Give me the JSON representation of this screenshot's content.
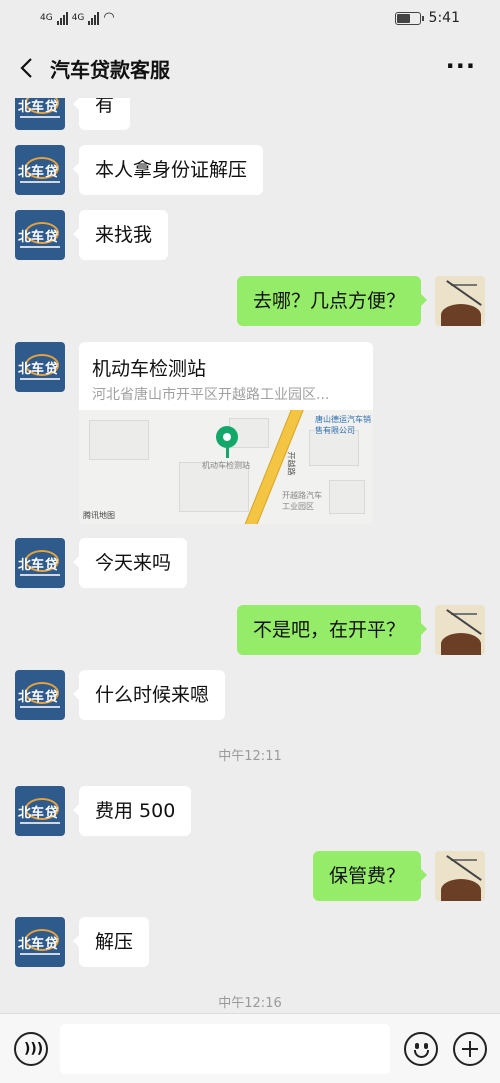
{
  "status_bar": {
    "network_1": "4G",
    "network_2": "4G",
    "time": "5:41",
    "battery_level": 0.6
  },
  "header": {
    "title": "汽车贷款客服"
  },
  "messages": [
    {
      "id": "m1",
      "side": "left",
      "text": "有"
    },
    {
      "id": "m2",
      "side": "left",
      "text": "本人拿身份证解压"
    },
    {
      "id": "m3",
      "side": "left",
      "text": "来找我"
    },
    {
      "id": "m4",
      "side": "right",
      "text": "去哪？几点方便？"
    },
    {
      "id": "m5",
      "side": "left",
      "type": "location"
    },
    {
      "id": "m6",
      "side": "left",
      "text": "今天来吗"
    },
    {
      "id": "m7",
      "side": "right",
      "text": "不是吧，在开平？"
    },
    {
      "id": "m8",
      "side": "left",
      "text": "什么时候来嗯"
    },
    {
      "id": "m9",
      "side": "left",
      "text": "费用 500"
    },
    {
      "id": "m10",
      "side": "right",
      "text": "保管费？"
    },
    {
      "id": "m11",
      "side": "left",
      "text": "解压"
    }
  ],
  "timestamps": [
    "中午12:11",
    "中午12:16"
  ],
  "location": {
    "name": "机动车检测站",
    "address": "河北省唐山市开平区开越路工业园区...",
    "map_labels": {
      "poi": "机动车检测站",
      "road": "开越路",
      "company": "唐山德运汽车销售有限公司",
      "park": "开越路汽车工业园区",
      "provider": "腾讯地图"
    }
  },
  "input_bar": {
    "voice_icon": "voice-icon",
    "emoji_icon": "emoji-icon",
    "plus_icon": "plus-icon"
  },
  "colors": {
    "background": "#ededed",
    "my_bubble": "#95ec69",
    "their_bubble": "#ffffff",
    "map_pin": "#11a86a"
  }
}
